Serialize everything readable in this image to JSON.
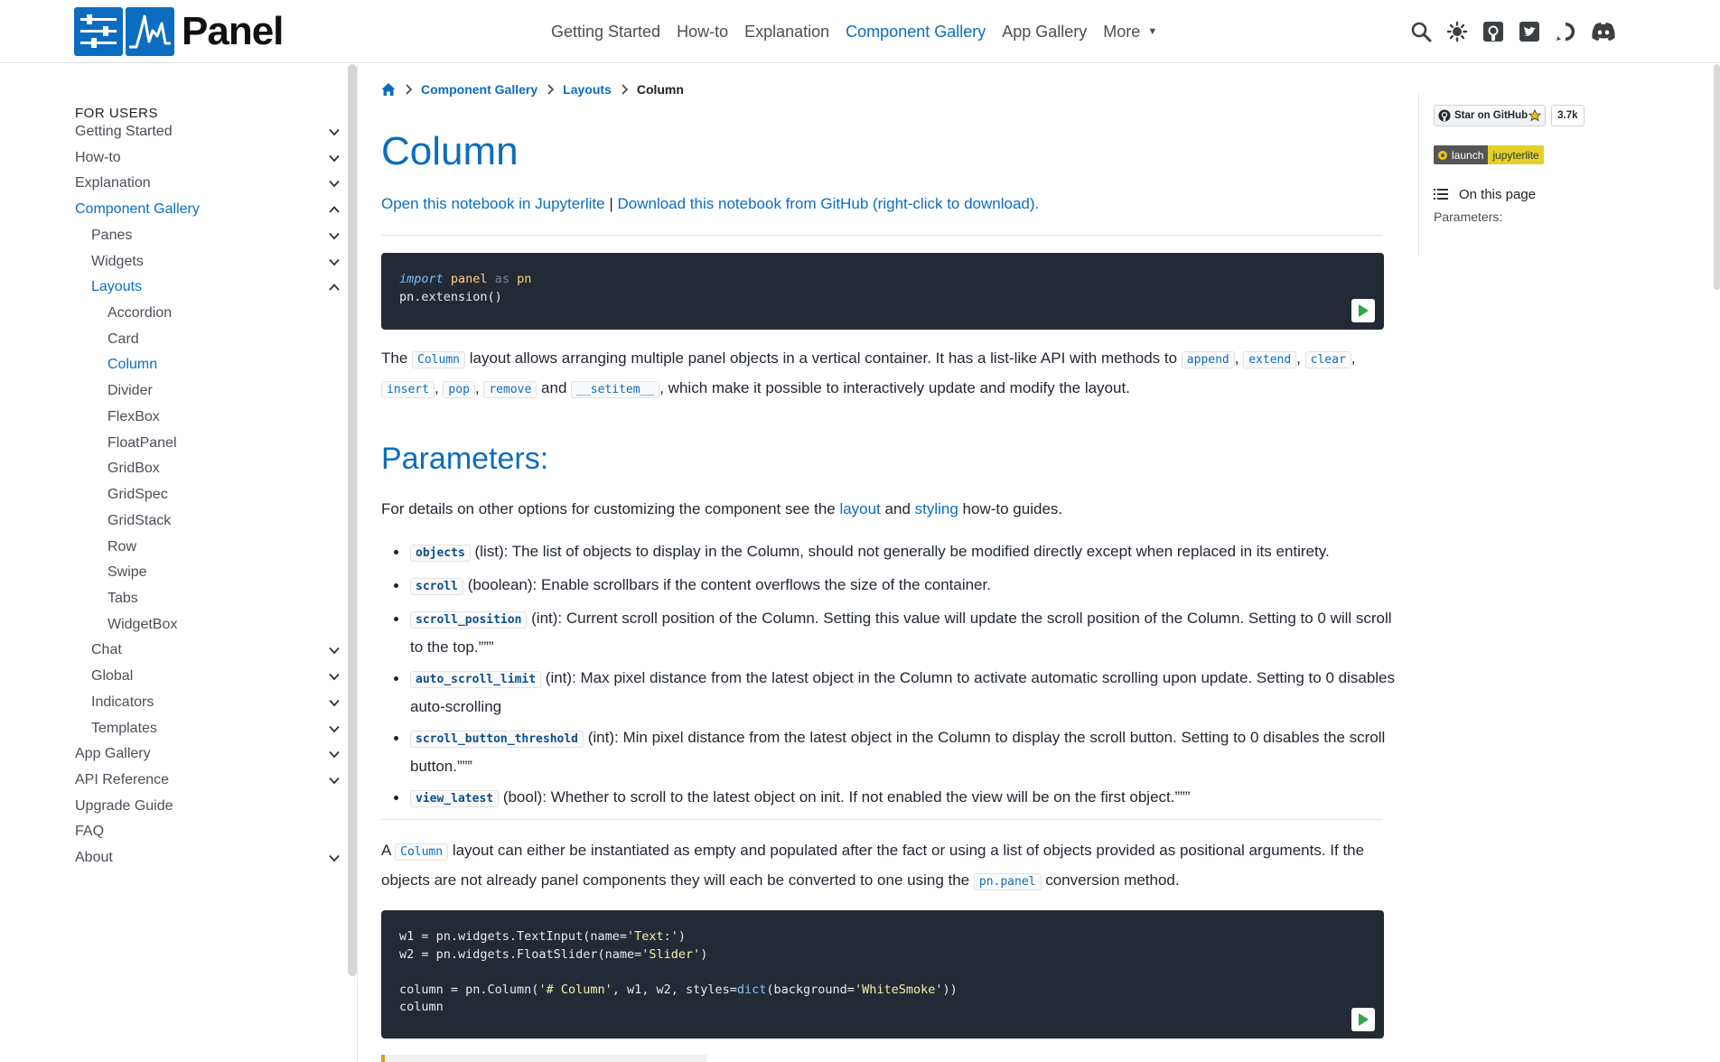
{
  "navbar": {
    "brand": "Panel",
    "links": [
      "Getting Started",
      "How-to",
      "Explanation",
      "Component Gallery",
      "App Gallery"
    ],
    "more_label": "More",
    "active_link": "Component Gallery",
    "icons": [
      "search-icon",
      "theme-toggle-icon",
      "github-icon",
      "twitter-icon",
      "discourse-icon",
      "discord-icon"
    ]
  },
  "sidebar": {
    "heading": "FOR USERS",
    "items": [
      {
        "label": "Getting Started",
        "expanded": false
      },
      {
        "label": "How-to",
        "expanded": false
      },
      {
        "label": "Explanation",
        "expanded": false
      },
      {
        "label": "Component Gallery",
        "expanded": true
      },
      {
        "label": "Panes",
        "expanded": false
      },
      {
        "label": "Widgets",
        "expanded": false
      },
      {
        "label": "Layouts",
        "expanded": true
      },
      {
        "label": "Accordion"
      },
      {
        "label": "Card"
      },
      {
        "label": "Column"
      },
      {
        "label": "Divider"
      },
      {
        "label": "FlexBox"
      },
      {
        "label": "FloatPanel"
      },
      {
        "label": "GridBox"
      },
      {
        "label": "GridSpec"
      },
      {
        "label": "GridStack"
      },
      {
        "label": "Row"
      },
      {
        "label": "Swipe"
      },
      {
        "label": "Tabs"
      },
      {
        "label": "WidgetBox"
      },
      {
        "label": "Chat",
        "expanded": false
      },
      {
        "label": "Global",
        "expanded": false
      },
      {
        "label": "Indicators",
        "expanded": false
      },
      {
        "label": "Templates",
        "expanded": false
      },
      {
        "label": "App Gallery",
        "expanded": false
      },
      {
        "label": "API Reference",
        "expanded": false
      },
      {
        "label": "Upgrade Guide"
      },
      {
        "label": "FAQ"
      },
      {
        "label": "About",
        "expanded": false
      }
    ]
  },
  "breadcrumb": {
    "items": [
      "Component Gallery",
      "Layouts",
      "Column"
    ]
  },
  "page": {
    "title": "Column",
    "open_jupyterlite": "Open this notebook in Jupyterlite",
    "link_separator": " | ",
    "download_github": "Download this notebook from GitHub (right-click to download)."
  },
  "code1": {
    "import": "import",
    "panel": "panel",
    "as": "as",
    "pn": "pn",
    "line2": "pn.extension()"
  },
  "intro": {
    "t1": "The ",
    "c1": "Column",
    "t2": " layout allows arranging multiple panel objects in a vertical container. It has a list-like API with methods to ",
    "c2": "append",
    "s1": ", ",
    "c3": "extend",
    "s2": ", ",
    "c4": "clear",
    "s3": ", ",
    "c5": "insert",
    "s4": ", ",
    "c6": "pop",
    "s5": ", ",
    "c7": "remove",
    "t3": " and ",
    "c8": "__setitem__",
    "t4": ", which make it possible to interactively update and modify the layout."
  },
  "params": {
    "heading": "Parameters:",
    "intro_t1": "For details on other options for customizing the component see the ",
    "layout_link": "layout",
    "intro_t2": " and ",
    "styling_link": "styling",
    "intro_t3": " how-to guides.",
    "items": [
      {
        "code": "objects",
        "text": " (list): The list of objects to display in the Column, should not generally be modified directly except when replaced in its entirety."
      },
      {
        "code": "scroll",
        "text": " (boolean): Enable scrollbars if the content overflows the size of the container."
      },
      {
        "code": "scroll_position",
        "text": " (int): Current scroll position of the Column. Setting this value will update the scroll position of the Column. Setting to 0 will scroll to the top.”””"
      },
      {
        "code": "auto_scroll_limit",
        "text": " (int): Max pixel distance from the latest object in the Column to activate automatic scrolling upon update. Setting to 0 disables auto-scrolling"
      },
      {
        "code": "scroll_button_threshold",
        "text": " (int): Min pixel distance from the latest object in the Column to display the scroll button. Setting to 0 disables the scroll button.”””"
      },
      {
        "code": "view_latest",
        "text": " (bool): Whether to scroll to the latest object on init. If not enabled the view will be on the first object.”””"
      }
    ]
  },
  "para2": {
    "t1": "A ",
    "c1": "Column",
    "t2": " layout can either be instantiated as empty and populated after the fact or using a list of objects provided as positional arguments. If the objects are not already panel components they will each be converted to one using the ",
    "c2": "pn.panel",
    "t3": " conversion method."
  },
  "code2": {
    "l1a": "w1 = pn.widgets.TextInput(name=",
    "l1s": "'Text:'",
    "l1b": ")",
    "l2a": "w2 = pn.widgets.FloatSlider(name=",
    "l2s": "'Slider'",
    "l2b": ")",
    "l3a": "column = pn.Column(",
    "l3s1": "'# Column'",
    "l3b": ", w1, w2, styles=",
    "l3f": "dict",
    "l3c": "(background=",
    "l3s2": "'WhiteSmoke'",
    "l3d": "))",
    "l4": "column"
  },
  "toc": {
    "star_label": "Star on GitHub",
    "star_count": "3.7k",
    "launch_label": "launch",
    "jupyterlite_label": "jupyterlite",
    "heading": "On this page",
    "items": [
      "Parameters:"
    ]
  },
  "colors": {
    "accent": "#0b6dbf",
    "code_bg": "#232a36",
    "jupyterlite_badge": "#e3d129"
  }
}
